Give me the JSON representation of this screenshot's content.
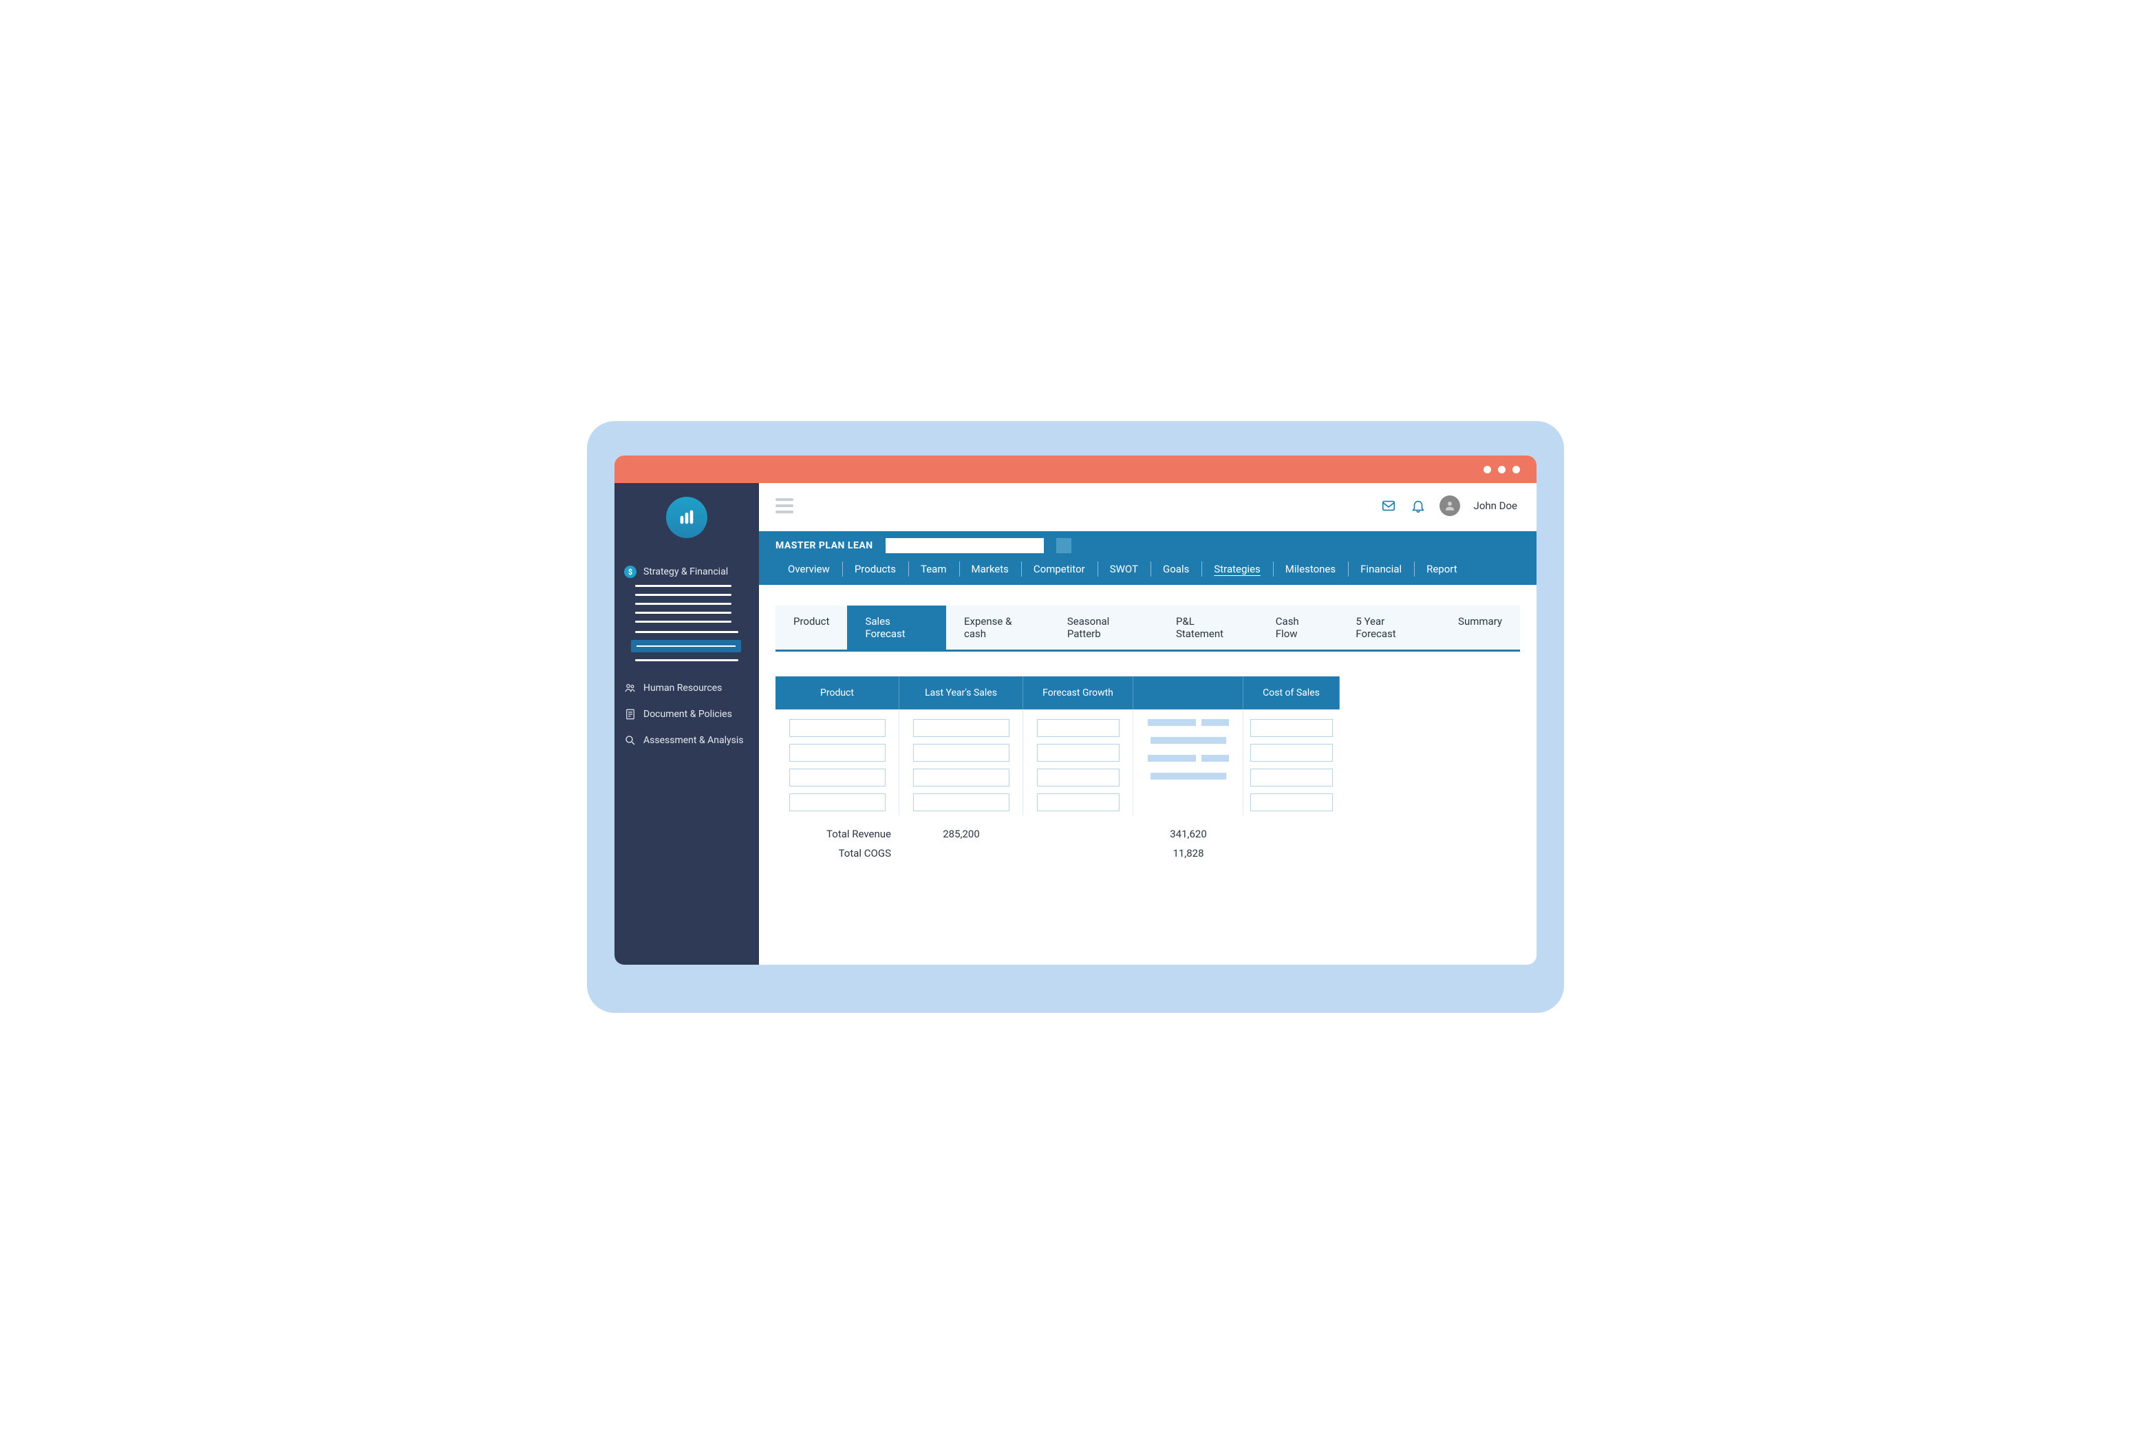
{
  "user": {
    "name": "John Doe"
  },
  "sidebar": {
    "items": [
      {
        "label": "Strategy & Financial"
      },
      {
        "label": "Human Resources"
      },
      {
        "label": "Document & Policies"
      },
      {
        "label": "Assessment & Analysis"
      }
    ]
  },
  "plan": {
    "title": "MASTER PLAN LEAN"
  },
  "tabs": [
    "Overview",
    "Products",
    "Team",
    "Markets",
    "Competitor",
    "SWOT",
    "Goals",
    "Strategies",
    "Milestones",
    "Financial",
    "Report"
  ],
  "active_tab": "Strategies",
  "subtabs": [
    "Product",
    "Sales Forecast",
    "Expense & cash",
    "Seasonal Patterb",
    "P&L Statement",
    "Cash Flow",
    "5 Year Forecast",
    "Summary"
  ],
  "active_subtab": "Sales Forecast",
  "table": {
    "headers": [
      "Product",
      "Last Year's Sales",
      "Forecast Growth",
      "",
      "Cost of Sales"
    ]
  },
  "totals": {
    "revenue_label": "Total Revenue",
    "cogs_label": "Total COGS",
    "last_year_total": "285,200",
    "forecast_total": "341,620",
    "cogs_total": "11,828"
  }
}
